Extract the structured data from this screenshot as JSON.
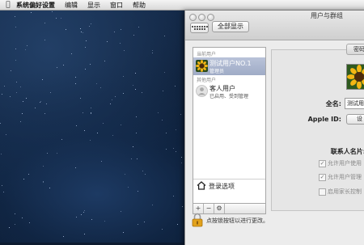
{
  "menubar": {
    "app_name": "系统偏好设置",
    "items": [
      "编辑",
      "显示",
      "窗口",
      "帮助"
    ]
  },
  "window": {
    "title": "用户与群组",
    "show_all": "全部显示"
  },
  "sidebar": {
    "current_users_label": "当前用户",
    "current_user": {
      "name": "测试用户NO.1",
      "role": "管理员"
    },
    "other_users_label": "其他用户",
    "guest_user": {
      "name": "客人用户",
      "status": "已启用、受到管理"
    },
    "login_options": "登录选项",
    "toolbar": {
      "add": "+",
      "remove": "−",
      "gear": "⚙"
    }
  },
  "detail": {
    "password_tab": "密码",
    "fullname_label": "全名:",
    "fullname_value": "测试用",
    "appleid_label": "Apple ID:",
    "appleid_button": "设",
    "contacts_label": "联系人名片:",
    "checkboxes": [
      {
        "label": "允许用户使用",
        "checked": true
      },
      {
        "label": "允许用户管理",
        "checked": true
      },
      {
        "label": "启用家长控制",
        "checked": false
      }
    ]
  },
  "footer": {
    "lock_text": "点按锁按钮以进行更改。"
  }
}
